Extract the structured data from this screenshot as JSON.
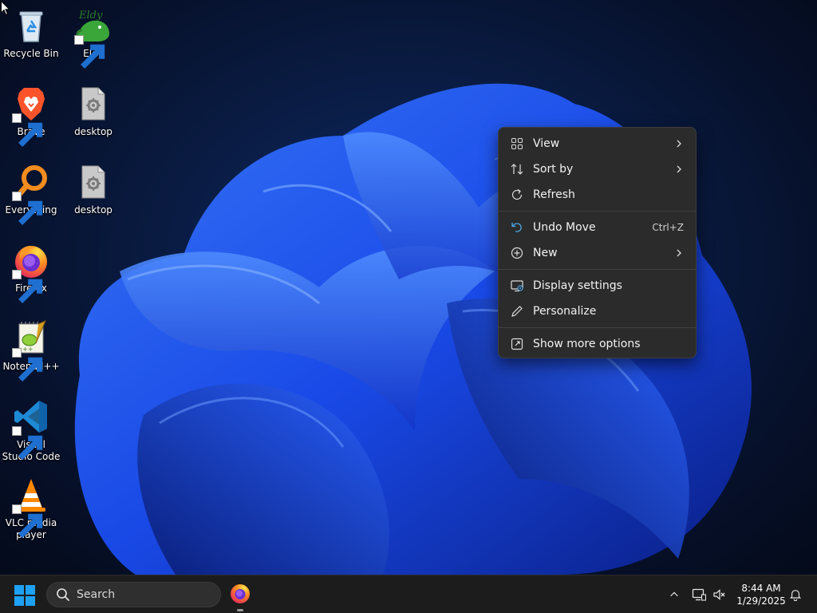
{
  "desktop_icons": [
    {
      "label": "Recycle Bin",
      "icon": "recycle-bin-icon"
    },
    {
      "label": "Eldy",
      "icon": "eldy-icon",
      "badge_text": "Eldy"
    },
    {
      "label": "Brave",
      "icon": "brave-icon"
    },
    {
      "label": "desktop",
      "icon": "settings-file-icon"
    },
    {
      "label": "Everything",
      "icon": "everything-search-icon"
    },
    {
      "label": "desktop",
      "icon": "settings-file-icon"
    },
    {
      "label": "Firefox",
      "icon": "firefox-icon"
    },
    {
      "label": "Notepad++",
      "icon": "notepad-plus-plus-icon"
    },
    {
      "label": "Visual Studio Code",
      "icon": "vscode-icon"
    },
    {
      "label": "VLC media player",
      "icon": "vlc-icon"
    }
  ],
  "context_menu": {
    "items": [
      {
        "label": "View",
        "icon": "grid-view-icon",
        "submenu": true
      },
      {
        "label": "Sort by",
        "icon": "sort-icon",
        "submenu": true
      },
      {
        "label": "Refresh",
        "icon": "refresh-icon"
      },
      {
        "label": "Undo Move",
        "icon": "undo-icon",
        "shortcut": "Ctrl+Z"
      },
      {
        "label": "New",
        "icon": "plus-circle-icon",
        "submenu": true
      },
      {
        "label": "Display settings",
        "icon": "display-settings-icon"
      },
      {
        "label": "Personalize",
        "icon": "pen-icon"
      },
      {
        "label": "Show more options",
        "icon": "external-link-icon"
      }
    ]
  },
  "taskbar": {
    "search_label": "Search",
    "pinned": [
      {
        "name": "Firefox",
        "icon": "firefox-icon",
        "running": true
      }
    ],
    "tray_icons": [
      "chevron-up-icon",
      "network-icon",
      "speaker-muted-icon",
      "notification-bell-icon"
    ],
    "clock": {
      "time": "8:44 AM",
      "date": "1/29/2025"
    }
  },
  "colors": {
    "accent": "#1e5cff",
    "menu_bg": "#2b2b2b",
    "taskbar_bg": "#1c1c1c",
    "windows_blue": "#1ea1f2"
  }
}
